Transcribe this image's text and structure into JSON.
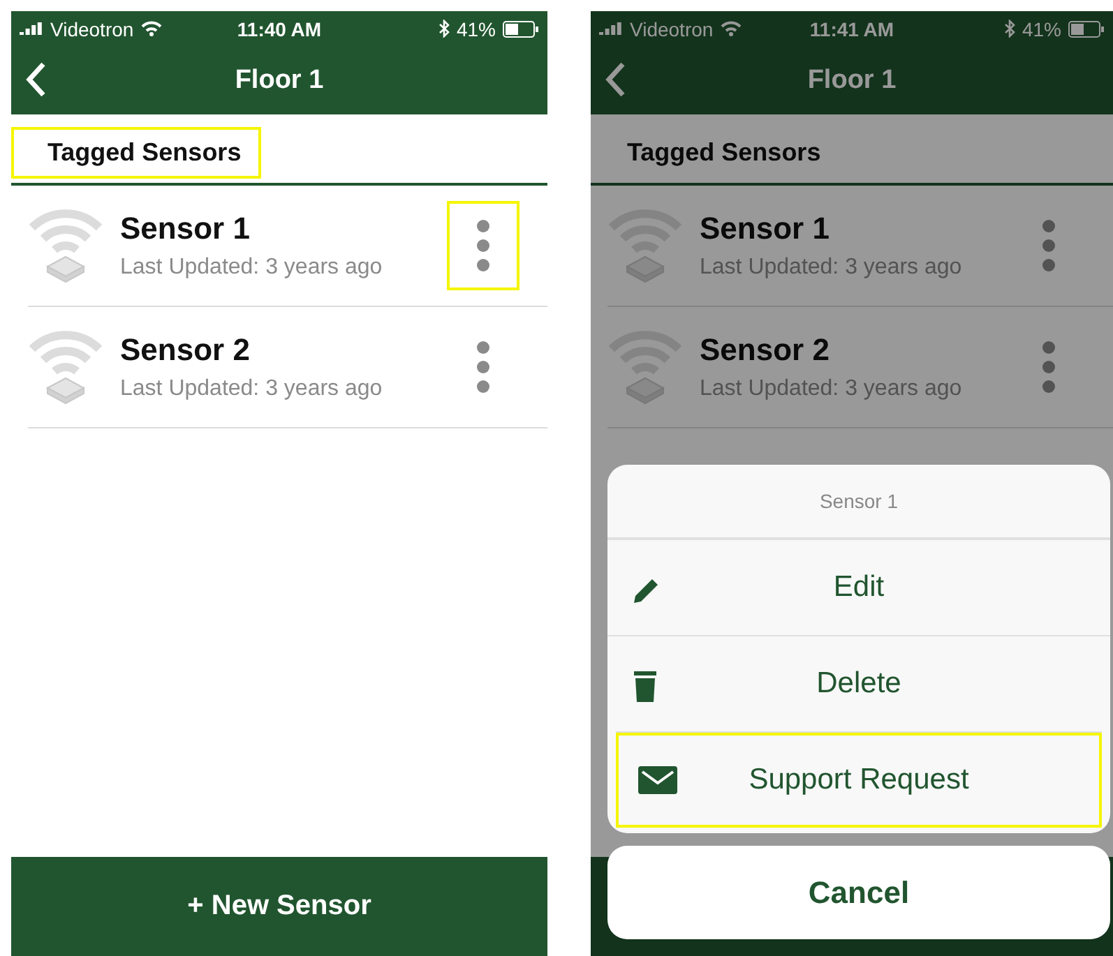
{
  "screens": [
    {
      "status": {
        "carrier": "Videotron",
        "time": "11:40 AM",
        "battery": "41%"
      },
      "title": "Floor 1",
      "section": {
        "label": "Tagged Sensors",
        "annotated": true
      },
      "sensors": [
        {
          "name": "Sensor 1",
          "updated": "Last Updated: 3 years ago",
          "menu_annotated": true
        },
        {
          "name": "Sensor 2",
          "updated": "Last Updated: 3 years ago",
          "menu_annotated": false
        }
      ],
      "footer_button": "+ New Sensor",
      "dimmed": false
    },
    {
      "status": {
        "carrier": "Videotron",
        "time": "11:41 AM",
        "battery": "41%"
      },
      "title": "Floor 1",
      "section": {
        "label": "Tagged Sensors",
        "annotated": false
      },
      "sensors": [
        {
          "name": "Sensor 1",
          "updated": "Last Updated: 3 years ago",
          "menu_annotated": false
        },
        {
          "name": "Sensor 2",
          "updated": "Last Updated: 3 years ago",
          "menu_annotated": false
        }
      ],
      "dimmed": true,
      "action_sheet": {
        "title": "Sensor 1",
        "items": [
          {
            "kind": "edit",
            "label": "Edit",
            "annotated": false
          },
          {
            "kind": "delete",
            "label": "Delete",
            "annotated": false
          },
          {
            "kind": "mail",
            "label": "Support Request",
            "annotated": true
          }
        ],
        "cancel": "Cancel"
      }
    }
  ]
}
